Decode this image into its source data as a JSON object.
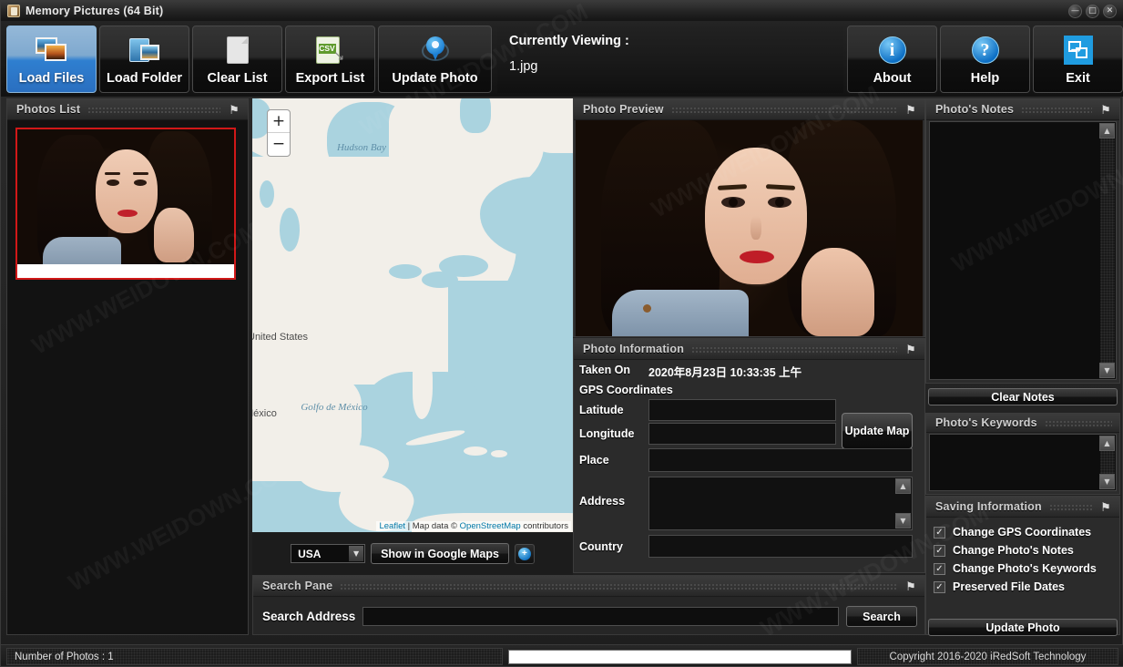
{
  "window": {
    "title": "Memory Pictures  (64 Bit)",
    "icon": "app-icon",
    "controls": {
      "minimize": "—",
      "maximize": "□",
      "close": "✕"
    }
  },
  "toolbar": {
    "buttons": [
      {
        "label": "Load Files",
        "icon": "photos-icon",
        "active": true
      },
      {
        "label": "Load Folder",
        "icon": "folder-icon",
        "active": false
      },
      {
        "label": "Clear List",
        "icon": "document-icon",
        "active": false
      },
      {
        "label": "Export List",
        "icon": "csv-export-icon",
        "active": false
      },
      {
        "label": "Update Photo",
        "icon": "map-pin-icon",
        "active": false
      }
    ],
    "right_buttons": [
      {
        "label": "About",
        "icon": "info-icon",
        "glyph": "i"
      },
      {
        "label": "Help",
        "icon": "help-icon",
        "glyph": "?"
      },
      {
        "label": "Exit",
        "icon": "exit-icon",
        "glyph": "↘"
      }
    ],
    "viewing_label": "Currently Viewing :",
    "viewing_value": "1.jpg"
  },
  "photos_list": {
    "title": "Photos List",
    "pin": "⚑",
    "selected_border_color": "#d01818"
  },
  "map": {
    "zoom_in": "+",
    "zoom_out": "−",
    "labels": [
      {
        "text": "Hudson Bay",
        "type": "water"
      },
      {
        "text": "United States",
        "type": "country"
      },
      {
        "text": "México",
        "type": "country"
      },
      {
        "text": "Golfo de México",
        "type": "water"
      }
    ],
    "attribution": {
      "leaflet": "Leaflet",
      "sep": " | ",
      "prefix": "Map data © ",
      "osm": "OpenStreetMap",
      "suffix": " contributors"
    },
    "country_select": {
      "value": "USA",
      "options": [
        "USA"
      ]
    },
    "google_maps_button": "Show in Google Maps",
    "zoom_search_icon": "magnifier-icon"
  },
  "photo_preview": {
    "title": "Photo Preview",
    "pin": "⚑"
  },
  "photo_information": {
    "title": "Photo Information",
    "pin": "⚑",
    "taken_on_label": "Taken On",
    "taken_on_value": "2020年8月23日 10:33:35 上午",
    "gps_header": "GPS Coordinates",
    "latitude_label": "Latitude",
    "latitude_value": "",
    "longitude_label": "Longitude",
    "longitude_value": "",
    "update_map_button": "Update Map",
    "place_label": "Place",
    "place_value": "",
    "address_label": "Address",
    "address_value": "",
    "country_label": "Country",
    "country_value": "",
    "scroll_up": "▲",
    "scroll_down": "▼"
  },
  "search_pane": {
    "title": "Search Pane",
    "pin": "⚑",
    "address_label": "Search Address",
    "address_value": "",
    "search_button": "Search"
  },
  "notes": {
    "title": "Photo's Notes",
    "pin": "⚑",
    "value": "",
    "scroll_up": "▲",
    "scroll_down": "▼",
    "clear_button": "Clear Notes"
  },
  "keywords": {
    "title": "Photo's Keywords",
    "value": "",
    "scroll_up": "▲",
    "scroll_down": "▼"
  },
  "saving_information": {
    "title": "Saving Information",
    "pin": "⚑",
    "check_glyph": "✓",
    "options": [
      {
        "label": "Change GPS Coordinates",
        "checked": true
      },
      {
        "label": "Change Photo's Notes",
        "checked": true
      },
      {
        "label": "Change Photo's Keywords",
        "checked": true
      },
      {
        "label": "Preserved File Dates",
        "checked": true
      }
    ],
    "update_button": "Update Photo"
  },
  "status_bar": {
    "photo_count": "Number of Photos : 1",
    "progress_value": "",
    "copyright": "Copyright 2016-2020 iRedSoft Technology"
  },
  "watermarks": [
    "WWW.WEIDOWN.COM",
    "WWW.WEIDOWN.COM",
    "WWW.WEIDOWN.COM",
    "WWW.WEIDOWN.COM",
    "WWW.WEIDOWN.COM",
    "WWW.WEIDOWN.COM"
  ]
}
